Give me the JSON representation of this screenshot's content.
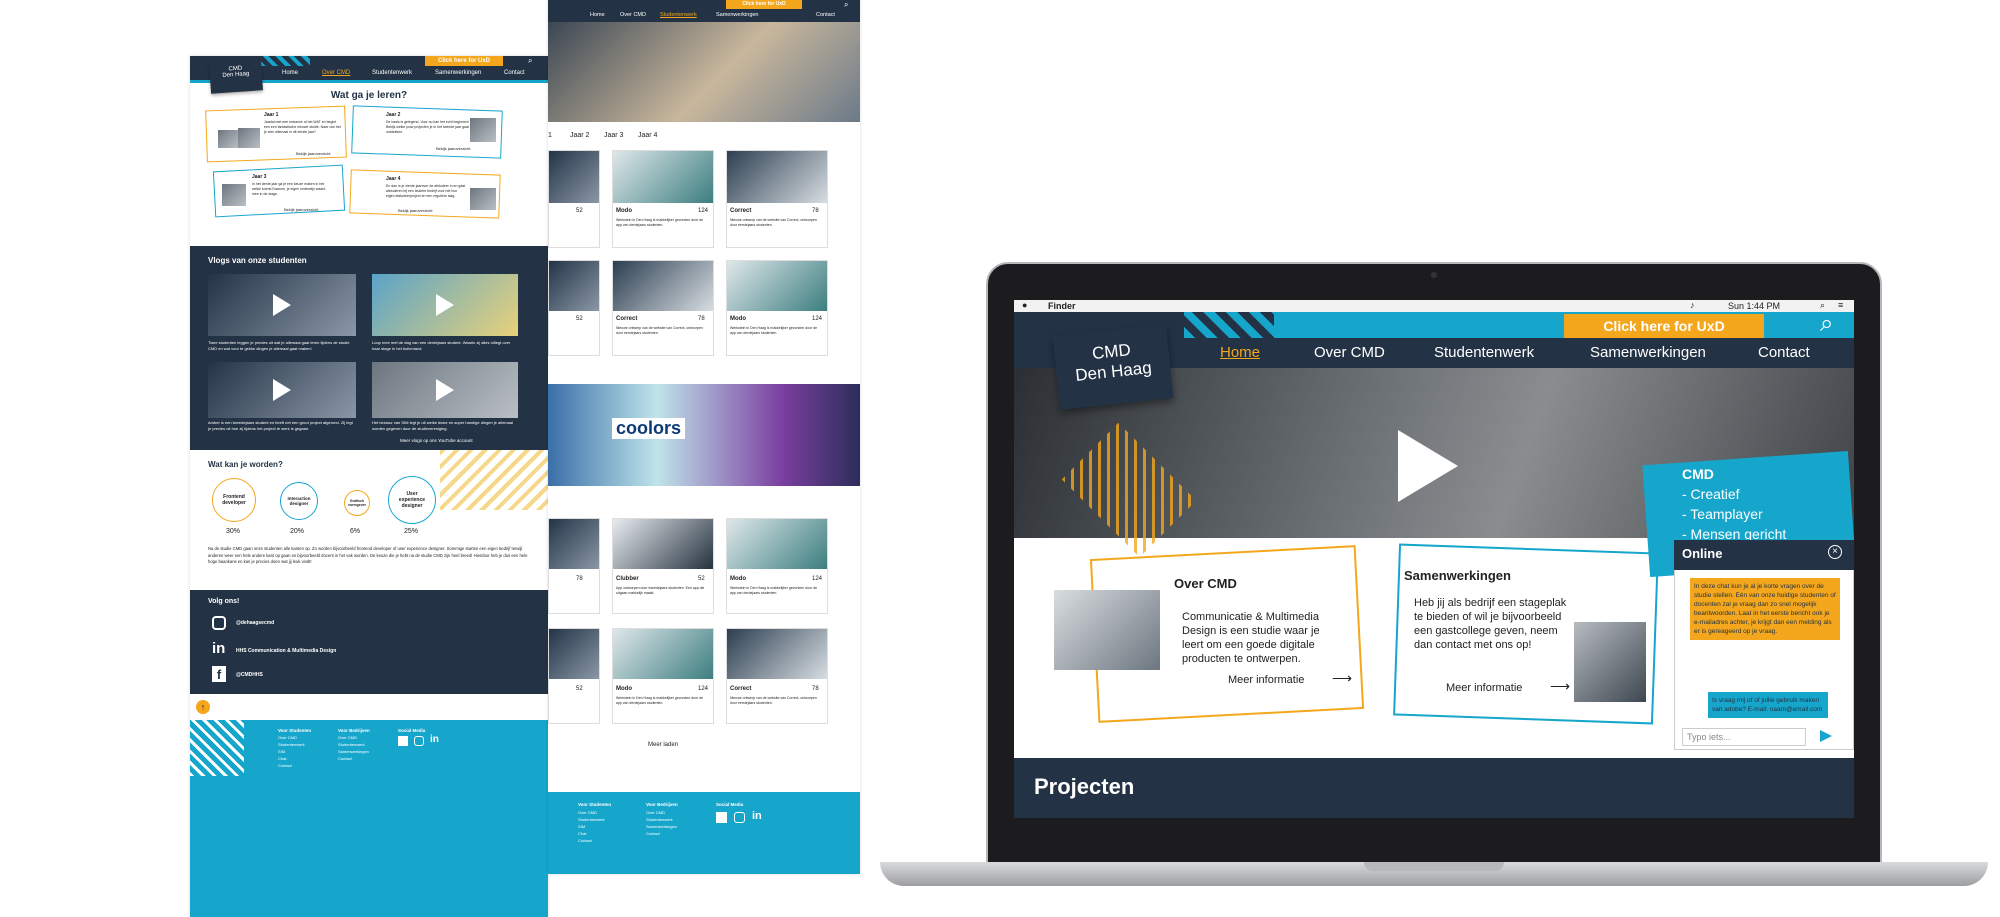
{
  "brand": {
    "line1": "CMD",
    "line2": "Den Haag"
  },
  "nav": {
    "home": "Home",
    "over": "Over CMD",
    "studentenwerk": "Studentenwerk",
    "samenwerkingen": "Samenwerkingen",
    "contact": "Contact"
  },
  "uxd_button": "Click here for UxD",
  "mobile_page": {
    "leren_title": "Wat ga je leren?",
    "jaren": [
      {
        "label": "Jaar 1",
        "text": "Jaartal met een entrance of het WAT en begint een een fantastische nieuwe studie. Naar van het je zien allemaal in dit eerste jaar?",
        "link": "Bekijk jaaroverzicht"
      },
      {
        "label": "Jaar 2",
        "text": "De basis is gelegend. Voor nu kan het echt beginnen! Bekijk welke jouw projecten je in het tweede jaar gaat ontdekken.",
        "link": "Bekijk jaaroverzicht"
      },
      {
        "label": "Jaar 3",
        "text": "In het derde jaar ga je een keuze maken in het welke koerst Daarom, je eigen onderwijs waard mee in de stage.",
        "link": "Bekijk jaaroverzicht"
      },
      {
        "label": "Jaar 4",
        "text": "En dan is je vierde jaarover de afstudeer in en gaat afstuderen bij een leukere bedrijf voor het hun eigen afstudeerproject en een reguliere slag.",
        "link": "Bekijk jaaroverzicht"
      }
    ],
    "vlogs_title": "Vlogs van onze studenten",
    "vlogs": [
      "Twee studenten leggen je precies uit wat je allemaal gaat leren tijdens de studie CMD en wat voor te gekke dingen je allemaal gaat maken!",
      "Loop mee met de dag van een derdejaars student. Waarin zij alles uitlegt over haar stage in het buitenland.",
      "Amber is een tweedejaars student en heeft net een groot project afgerond. Zij legt je precies uit hoe zij tijdens het project te werk is gegaan.",
      "Het bestuur van SIM legt je uit welke leuke en super handige dingen je allemaal worden gegeven door de studievereniging."
    ],
    "vlogs_more": "Meer vlogs op ons YouTube account",
    "worden_title": "Wat kan je worden?",
    "roles": [
      {
        "name": "Frontend developer",
        "pct": "30%"
      },
      {
        "name": "Interaction designer",
        "pct": "20%"
      },
      {
        "name": "Grafisch vormgever",
        "pct": "6%"
      },
      {
        "name": "User experience designer",
        "pct": "25%"
      }
    ],
    "worden_text": "Na de studie CMD gaan onze studenten alle kanten op. Zo worden bijvoorbeeld frontend developer of user experience designer. Sommige starten een eigen bedrijf terwijl anderen weer een hele andere kant op gaan en bijvoorbeeld docent in het vak worden. De keuze die je hebt na de studie CMD zijn heel breed! Hierdoor heb je dus een hele hoge baankans en kan je precies doen wat jij leuk vindt!",
    "volg_title": "Volg ons!",
    "socials": [
      {
        "icon": "instagram-icon",
        "label": "@dehaagsecmd"
      },
      {
        "icon": "linkedin-icon",
        "label": "HHS Communication & Multimedia Design"
      },
      {
        "icon": "facebook-icon",
        "label": "@CMDHHS"
      }
    ]
  },
  "footer": {
    "col1_title": "Voor Studenten",
    "col1": [
      "Over CMD",
      "Studentenwerk",
      "SIM",
      "Chat",
      "Contact"
    ],
    "col2_title": "Voor Bedrijven",
    "col2": [
      "Over CMD",
      "Studentenwerk",
      "Samenwerkingen",
      "Contact"
    ],
    "col3_title": "Social Media"
  },
  "projects_page": {
    "year_tabs": [
      "1",
      "Jaar 2",
      "Jaar 3",
      "Jaar 4"
    ],
    "row1": [
      {
        "name": "",
        "likes": "52"
      },
      {
        "name": "Modo",
        "likes": "124",
        "desc": "Werkstein in Den Haag is makkelijker gevonden door de app van derdejaars studenten."
      },
      {
        "name": "Correct",
        "likes": "78",
        "desc": "Nieuwe ontwerp van de website van Correct, ontworpen door eerstejaars studenten."
      }
    ],
    "row2": [
      {
        "name": "",
        "likes": "52"
      },
      {
        "name": "Correct",
        "likes": "78",
        "desc": "Nieuwe ontwerp van de website van Correct, ontworpen door eerstejaars studenten."
      },
      {
        "name": "Modo",
        "likes": "124",
        "desc": "Werkstein in Den Haag is makkelijker gevonden door de app van derdejaars studenten."
      }
    ],
    "banner_text": "coolors",
    "row3": [
      {
        "name": "",
        "likes": "78"
      },
      {
        "name": "Clubber",
        "likes": "52",
        "desc": "App ontworpen door tweedejaars studenten. Een app die uitgaan makkelijk maakt."
      },
      {
        "name": "Modo",
        "likes": "124",
        "desc": "Werkstein in Den Haag is makkelijker gevonden door de app van derdejaars studenten."
      }
    ],
    "row4": [
      {
        "name": "",
        "likes": "52"
      },
      {
        "name": "Modo",
        "likes": "124",
        "desc": "Werkstein in Den Haag is makkelijker gevonden door de app van derdejaars studenten."
      },
      {
        "name": "Correct",
        "likes": "78",
        "desc": "Nieuwe ontwerp van de website van Correct, ontworpen door eerstejaars studenten."
      }
    ],
    "meer_laden": "Meer laden"
  },
  "laptop": {
    "menubar_app": "Finder",
    "menubar_time": "Sun 1:44 PM",
    "hero_lines": [
      "CMD",
      "- Creatief",
      "- Teamplayer",
      "- Mensen gericht"
    ],
    "over_title": "Over CMD",
    "over_text": "Communicatie & Multimedia Design is een studie waar je leert om een goede digitale producten te ontwerpen.",
    "over_link": "Meer informatie",
    "samen_title": "Samenwerkingen",
    "samen_text": "Heb jij als bedrijf een stageplak te bieden of wil je bijvoorbeeld een gastcollege geven, neem dan contact met ons op!",
    "samen_link": "Meer informatie",
    "projecten": "Projecten",
    "chat": {
      "title": "Online",
      "msg1": "In deze chat kun je al je korte vragen over de studie stellen. Eén van onze huidige studenten of docenten zal je vraag dan zo snel mogelijk beantwoorden. Laat in het eerste bericht ook je e-mailadres achter, je krijgt dan een melding als er is gereageerd op je vraag.",
      "msg2": "Is vraag mij of of jullie gebruik maken van adobe? E-mail: naam@email.com",
      "placeholder": "Typo iets..."
    }
  },
  "colors": {
    "navy": "#233345",
    "cyan": "#16a6cc",
    "orange": "#f4a71c"
  }
}
